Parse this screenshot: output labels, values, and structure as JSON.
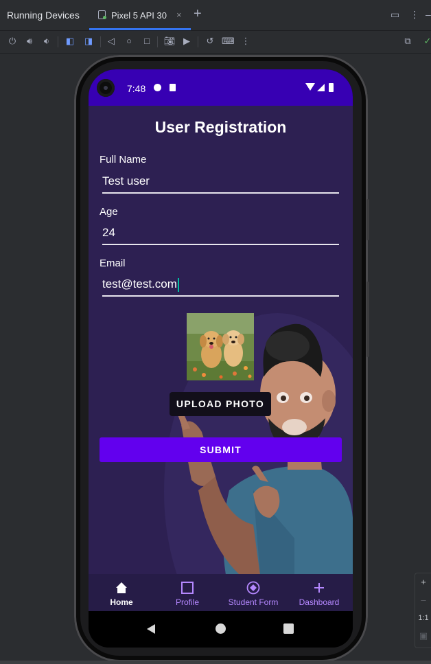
{
  "ide": {
    "panel_title": "Running Devices",
    "tab_label": "Pixel 5 API 30",
    "tab_close": "×",
    "add_tab": "+",
    "side_zoom_in": "+",
    "side_zoom_out": "–",
    "side_actual_size": "1:1"
  },
  "phone": {
    "status_time": "7:48"
  },
  "app": {
    "title": "User Registration",
    "fields": {
      "full_name": {
        "label": "Full Name",
        "value": "Test user"
      },
      "age": {
        "label": "Age",
        "value": "24"
      },
      "email": {
        "label": "Email",
        "value": "test@test.com"
      }
    },
    "upload_button": "UPLOAD PHOTO",
    "submit_button": "SUBMIT",
    "nav": [
      {
        "label": "Home",
        "icon": "home-icon",
        "active": true
      },
      {
        "label": "Profile",
        "icon": "square-outline-icon",
        "active": false
      },
      {
        "label": "Student Form",
        "icon": "diamond-circle-icon",
        "active": false
      },
      {
        "label": "Dashboard",
        "icon": "plus-icon",
        "active": false
      }
    ]
  },
  "colors": {
    "status_bar": "#3700b3",
    "background": "#2d2052",
    "primary_button": "#6200ee",
    "nav_accent": "#b588ff"
  }
}
